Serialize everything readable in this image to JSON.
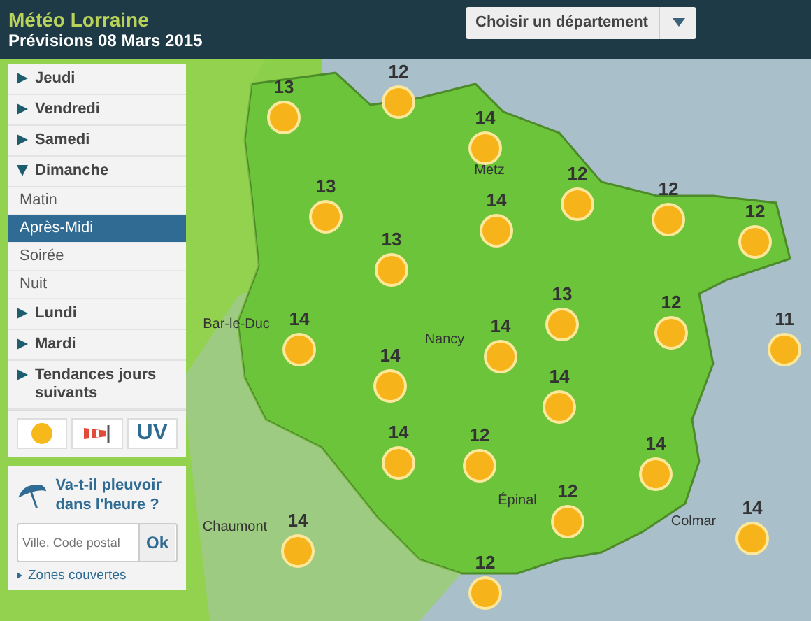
{
  "header": {
    "title": "Météo Lorraine",
    "subtitle": "Prévisions 08 Mars 2015",
    "department_select": {
      "value": "Choisir un département"
    }
  },
  "days": [
    {
      "label": "Jeudi",
      "expanded": false
    },
    {
      "label": "Vendredi",
      "expanded": false
    },
    {
      "label": "Samedi",
      "expanded": false
    },
    {
      "label": "Dimanche",
      "expanded": true,
      "children": [
        {
          "label": "Matin",
          "selected": false
        },
        {
          "label": "Après-Midi",
          "selected": true
        },
        {
          "label": "Soirée",
          "selected": false
        },
        {
          "label": "Nuit",
          "selected": false
        }
      ]
    },
    {
      "label": "Lundi",
      "expanded": false
    },
    {
      "label": "Mardi",
      "expanded": false
    },
    {
      "label": "Tendances jours suivants",
      "expanded": false
    }
  ],
  "map_modes": [
    {
      "kind": "sun"
    },
    {
      "kind": "wind"
    },
    {
      "kind": "text",
      "label": "UV"
    }
  ],
  "rain_widget": {
    "question": "Va-t-il pleuvoir dans l'heure ?",
    "placeholder": "Ville, Code postal",
    "button": "Ok",
    "link": "Zones couvertes"
  },
  "map": {
    "cities": [
      "Metz",
      "Bar-le-Duc",
      "Nancy",
      "Épinal",
      "Chaumont",
      "Colmar"
    ],
    "temperatures": [
      "12",
      "13",
      "14",
      "12",
      "13",
      "12",
      "14",
      "12",
      "13",
      "13",
      "12",
      "14",
      "11",
      "14",
      "14",
      "14",
      "14",
      "12",
      "14",
      "12",
      "14",
      "14",
      "12"
    ]
  }
}
